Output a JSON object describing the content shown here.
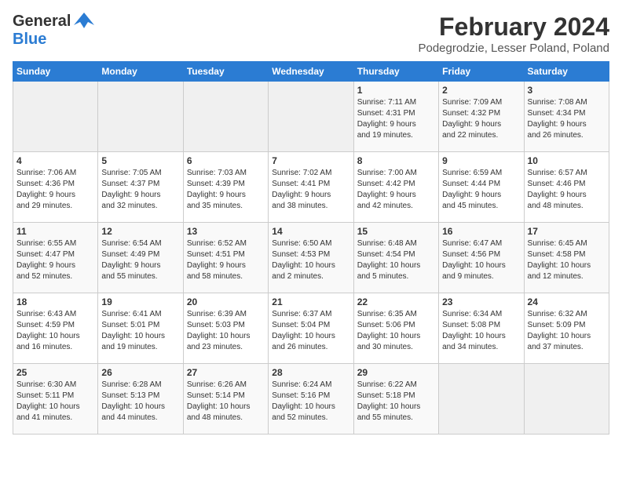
{
  "header": {
    "logo_line1": "General",
    "logo_line2": "Blue",
    "title": "February 2024",
    "subtitle": "Podegrodzie, Lesser Poland, Poland"
  },
  "days_of_week": [
    "Sunday",
    "Monday",
    "Tuesday",
    "Wednesday",
    "Thursday",
    "Friday",
    "Saturday"
  ],
  "weeks": [
    [
      {
        "day": "",
        "info": ""
      },
      {
        "day": "",
        "info": ""
      },
      {
        "day": "",
        "info": ""
      },
      {
        "day": "",
        "info": ""
      },
      {
        "day": "1",
        "info": "Sunrise: 7:11 AM\nSunset: 4:31 PM\nDaylight: 9 hours\nand 19 minutes."
      },
      {
        "day": "2",
        "info": "Sunrise: 7:09 AM\nSunset: 4:32 PM\nDaylight: 9 hours\nand 22 minutes."
      },
      {
        "day": "3",
        "info": "Sunrise: 7:08 AM\nSunset: 4:34 PM\nDaylight: 9 hours\nand 26 minutes."
      }
    ],
    [
      {
        "day": "4",
        "info": "Sunrise: 7:06 AM\nSunset: 4:36 PM\nDaylight: 9 hours\nand 29 minutes."
      },
      {
        "day": "5",
        "info": "Sunrise: 7:05 AM\nSunset: 4:37 PM\nDaylight: 9 hours\nand 32 minutes."
      },
      {
        "day": "6",
        "info": "Sunrise: 7:03 AM\nSunset: 4:39 PM\nDaylight: 9 hours\nand 35 minutes."
      },
      {
        "day": "7",
        "info": "Sunrise: 7:02 AM\nSunset: 4:41 PM\nDaylight: 9 hours\nand 38 minutes."
      },
      {
        "day": "8",
        "info": "Sunrise: 7:00 AM\nSunset: 4:42 PM\nDaylight: 9 hours\nand 42 minutes."
      },
      {
        "day": "9",
        "info": "Sunrise: 6:59 AM\nSunset: 4:44 PM\nDaylight: 9 hours\nand 45 minutes."
      },
      {
        "day": "10",
        "info": "Sunrise: 6:57 AM\nSunset: 4:46 PM\nDaylight: 9 hours\nand 48 minutes."
      }
    ],
    [
      {
        "day": "11",
        "info": "Sunrise: 6:55 AM\nSunset: 4:47 PM\nDaylight: 9 hours\nand 52 minutes."
      },
      {
        "day": "12",
        "info": "Sunrise: 6:54 AM\nSunset: 4:49 PM\nDaylight: 9 hours\nand 55 minutes."
      },
      {
        "day": "13",
        "info": "Sunrise: 6:52 AM\nSunset: 4:51 PM\nDaylight: 9 hours\nand 58 minutes."
      },
      {
        "day": "14",
        "info": "Sunrise: 6:50 AM\nSunset: 4:53 PM\nDaylight: 10 hours\nand 2 minutes."
      },
      {
        "day": "15",
        "info": "Sunrise: 6:48 AM\nSunset: 4:54 PM\nDaylight: 10 hours\nand 5 minutes."
      },
      {
        "day": "16",
        "info": "Sunrise: 6:47 AM\nSunset: 4:56 PM\nDaylight: 10 hours\nand 9 minutes."
      },
      {
        "day": "17",
        "info": "Sunrise: 6:45 AM\nSunset: 4:58 PM\nDaylight: 10 hours\nand 12 minutes."
      }
    ],
    [
      {
        "day": "18",
        "info": "Sunrise: 6:43 AM\nSunset: 4:59 PM\nDaylight: 10 hours\nand 16 minutes."
      },
      {
        "day": "19",
        "info": "Sunrise: 6:41 AM\nSunset: 5:01 PM\nDaylight: 10 hours\nand 19 minutes."
      },
      {
        "day": "20",
        "info": "Sunrise: 6:39 AM\nSunset: 5:03 PM\nDaylight: 10 hours\nand 23 minutes."
      },
      {
        "day": "21",
        "info": "Sunrise: 6:37 AM\nSunset: 5:04 PM\nDaylight: 10 hours\nand 26 minutes."
      },
      {
        "day": "22",
        "info": "Sunrise: 6:35 AM\nSunset: 5:06 PM\nDaylight: 10 hours\nand 30 minutes."
      },
      {
        "day": "23",
        "info": "Sunrise: 6:34 AM\nSunset: 5:08 PM\nDaylight: 10 hours\nand 34 minutes."
      },
      {
        "day": "24",
        "info": "Sunrise: 6:32 AM\nSunset: 5:09 PM\nDaylight: 10 hours\nand 37 minutes."
      }
    ],
    [
      {
        "day": "25",
        "info": "Sunrise: 6:30 AM\nSunset: 5:11 PM\nDaylight: 10 hours\nand 41 minutes."
      },
      {
        "day": "26",
        "info": "Sunrise: 6:28 AM\nSunset: 5:13 PM\nDaylight: 10 hours\nand 44 minutes."
      },
      {
        "day": "27",
        "info": "Sunrise: 6:26 AM\nSunset: 5:14 PM\nDaylight: 10 hours\nand 48 minutes."
      },
      {
        "day": "28",
        "info": "Sunrise: 6:24 AM\nSunset: 5:16 PM\nDaylight: 10 hours\nand 52 minutes."
      },
      {
        "day": "29",
        "info": "Sunrise: 6:22 AM\nSunset: 5:18 PM\nDaylight: 10 hours\nand 55 minutes."
      },
      {
        "day": "",
        "info": ""
      },
      {
        "day": "",
        "info": ""
      }
    ]
  ]
}
